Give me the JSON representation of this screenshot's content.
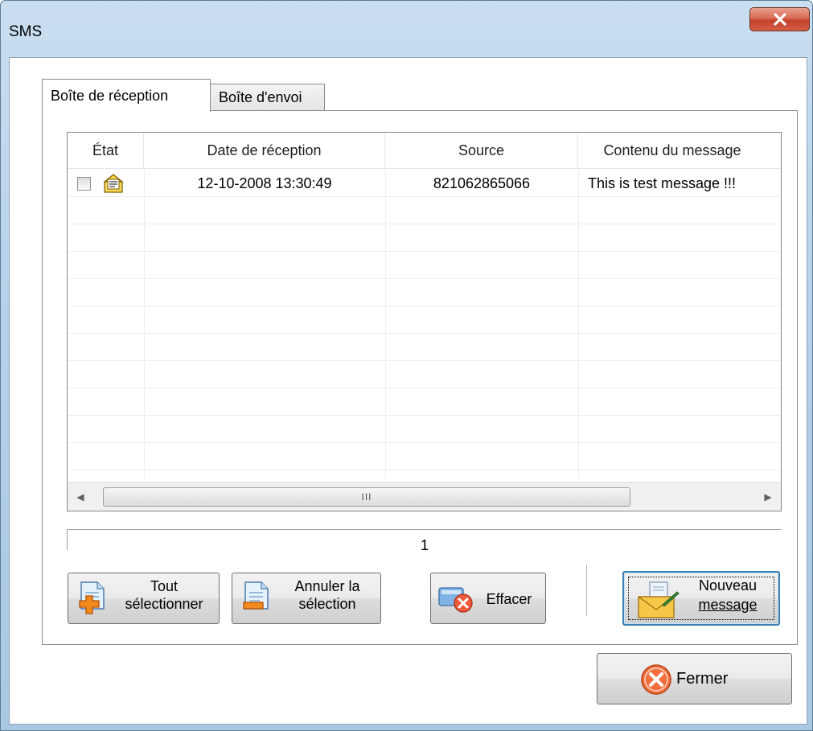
{
  "window": {
    "title": "SMS"
  },
  "tabs": [
    {
      "label": "Boîte de réception",
      "active": true
    },
    {
      "label": "Boîte d'envoi",
      "active": false
    }
  ],
  "list": {
    "columns": [
      "État",
      "Date de réception",
      "Source",
      "Contenu du message"
    ],
    "rows": [
      {
        "checked": false,
        "status_icon": "unread-envelope-icon",
        "date": "12-10-2008  13:30:49",
        "source": "821062865066",
        "content": "This is test message !!!"
      }
    ],
    "scroll_thumb_grip": "III"
  },
  "pager": {
    "page": "1"
  },
  "buttons": {
    "select_all": {
      "line1": "Tout",
      "line2": "sélectionner"
    },
    "deselect": {
      "line1": "Annuler la",
      "line2": "sélection"
    },
    "delete": {
      "label": "Effacer"
    },
    "new_message": {
      "line1": "Nouveau",
      "line2": "message"
    },
    "close": {
      "label": "Fermer"
    }
  },
  "colors": {
    "title_bar": "#b7d2ea",
    "close_button": "#c2412a",
    "focus_border": "#3c7fb1"
  }
}
